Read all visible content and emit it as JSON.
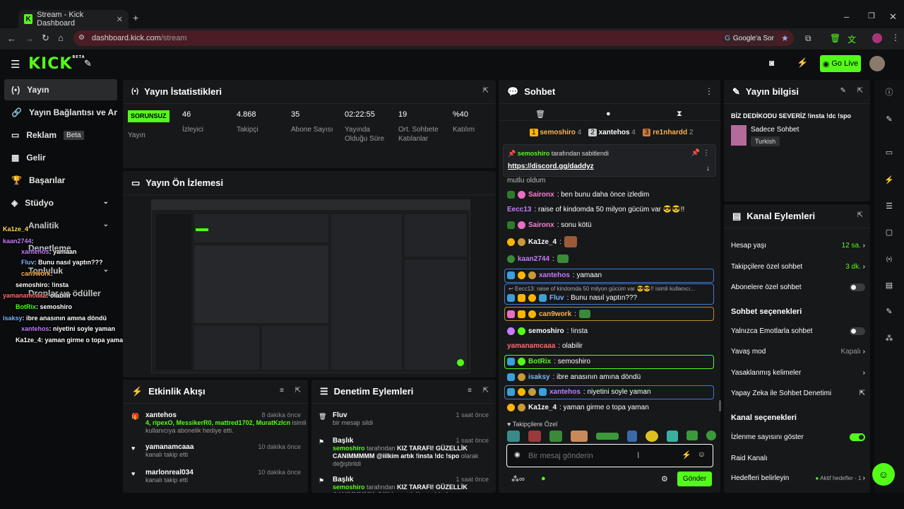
{
  "browser": {
    "tab_title": "Stream - Kick Dashboard",
    "url_host": "dashboard.kick.com",
    "url_path": "/stream",
    "ask_label": "Google'a Sor"
  },
  "header": {
    "logo": "KICK",
    "logo_beta": "BETA",
    "go_live": "Go Live"
  },
  "sidebar": {
    "items": [
      {
        "label": "Yayın"
      },
      {
        "label": "Yayın Bağlantısı ve Anahtar"
      },
      {
        "label": "Reklam",
        "badge": "Beta"
      },
      {
        "label": "Gelir"
      },
      {
        "label": "Başarılar"
      },
      {
        "label": "Stüdyo"
      },
      {
        "label": "Analitik"
      },
      {
        "label": "Denetleme"
      },
      {
        "label": "Topluluk"
      },
      {
        "label": "Droplar ve ödüller"
      }
    ]
  },
  "overlay_chat": [
    {
      "user": "Ka1ze_4",
      "text": ""
    },
    {
      "user": "kaan2744",
      "text": ":"
    },
    {
      "user": "xantehos",
      "text": ": yamaan"
    },
    {
      "user": "Fluv",
      "text": ": Bunu nasıl yaptın???"
    },
    {
      "user": "can9work",
      "text": ":"
    },
    {
      "user": "semoshiro",
      "text": ": !insta"
    },
    {
      "user": "yamanamcaaa",
      "text": ": olabilir"
    },
    {
      "user": "BotRix",
      "text": ": semoshiro"
    },
    {
      "user": "isaksy",
      "text": ": ibre anasının amına döndü"
    },
    {
      "user": "xantehos",
      "text": ": niyetini soyle yaman"
    },
    {
      "user": "Ka1ze_4",
      "text": ": yaman girme o topa yaman"
    }
  ],
  "stats": {
    "title": "Yayın İstatistikleri",
    "status_badge": "SORUNSUZ",
    "status_label": "Yayın",
    "items": [
      {
        "value": "46",
        "label": "İzleyici"
      },
      {
        "value": "4.868",
        "label": "Takipçi"
      },
      {
        "value": "35",
        "label": "Abone Sayısı"
      },
      {
        "value": "02:22:55",
        "label": "Yayında Olduğu Süre"
      },
      {
        "value": "19",
        "label": "Ort. Sohbete Katılanlar"
      },
      {
        "value": "%40",
        "label": "Katılım"
      }
    ]
  },
  "preview": {
    "title": "Yayın Ön İzlemesi"
  },
  "activity": {
    "title": "Etkinlik Akışı",
    "events": [
      {
        "name": "xantehos",
        "time": "8 dakika önce",
        "gifted": "4, ripexO, MessikerR0, mattred1702, MuratKzIcn",
        "desc": "isimli kullanıcıya abonelik hediye etti."
      },
      {
        "name": "yamanamcaaa",
        "time": "10 dakika önce",
        "desc": "kanalı takip etti"
      },
      {
        "name": "marlonreal034",
        "time": "10 dakika önce",
        "desc": "kanalı takip etti"
      }
    ]
  },
  "moderation": {
    "title": "Denetim Eylemleri",
    "actions": [
      {
        "name": "Fluv",
        "time": "1 saat önce",
        "desc": "bir mesajı sildi"
      },
      {
        "name": "Başlık",
        "time": "1 saat önce",
        "actor": "semoshiro",
        "desc_mid": "tarafından",
        "title_text": "KIZ TARAFI! GÜZELLİK CANIMMMMM @iilkim artık !insta !dc !spo",
        "desc_end": "olarak değiştirildi"
      },
      {
        "name": "Başlık",
        "time": "1 saat önce",
        "actor": "semoshiro",
        "desc_mid": "tarafından",
        "title_text": "KIZ TARAFI! GÜZELLİK CANIMMMMM @iilkim artık !insta !dc !spo"
      }
    ]
  },
  "chat": {
    "title": "Sohbet",
    "top_gifters": [
      {
        "rank": "1",
        "name": "semoshiro",
        "count": "4"
      },
      {
        "rank": "2",
        "name": "xantehos",
        "count": "4"
      },
      {
        "rank": "3",
        "name": "re1nhardd",
        "count": "2"
      }
    ],
    "pinned_by": "semoshiro",
    "pinned_label": "tarafından sabitlendi",
    "pinned_link": "https://discord.gg/daddyz",
    "partial_line": "mutlu oldum",
    "messages": [
      {
        "user": "Saironx",
        "text": ": ben bunu daha önce izledim",
        "color": "#ff7fd5"
      },
      {
        "user": "Eecc13",
        "text": ": raise of kindomda 50 milyon gücüm var 😎😎!!",
        "color": "#c57cff"
      },
      {
        "user": "Saironx",
        "text": ": sonu kötü",
        "color": "#ff7fd5"
      },
      {
        "user": "Ka1ze_4",
        "text": ":",
        "color": "#ffffff"
      },
      {
        "user": "kaan2744",
        "text": ":",
        "color": "#c57cff"
      },
      {
        "user": "xantehos",
        "text": ": yamaan",
        "color": "#c57cff"
      },
      {
        "reply": "Eecc13: raise of kindomda 50 milyon gücüm var 😎😎!! isimli kullanıcı...",
        "user": "Fluv",
        "text": ": Bunu nasıl yaptın???",
        "color": "#7ab7ff"
      },
      {
        "user": "can9work",
        "text": ":",
        "color": "#ffb14a"
      },
      {
        "user": "semoshiro",
        "text": ": !insta",
        "color": "#ffffff"
      },
      {
        "user": "yamanamcaaa",
        "text": ": olabilir",
        "color": "#ff6b6b"
      },
      {
        "user": "BotRix",
        "text": ": semoshiro",
        "color": "#53fc18"
      },
      {
        "user": "isaksy",
        "text": ": ibre anasının amına döndü",
        "color": "#7ab7ff"
      },
      {
        "user": "xantehos",
        "text": ": niyetini soyle yaman",
        "color": "#c57cff"
      },
      {
        "user": "Ka1ze_4",
        "text": ": yaman girme o topa yaman",
        "color": "#ffffff"
      }
    ],
    "emote_label": "Takipçilere Özel",
    "input_placeholder": "Bir mesaj gönderin",
    "send": "Gönder"
  },
  "stream_info": {
    "title": "Yayın bilgisi",
    "stream_title": "BİZ DEDİKODU SEVERİZ !insta !dc !spo",
    "category": "Sadece Sohbet",
    "tag": "Turkish"
  },
  "channel_actions": {
    "title": "Kanal Eylemleri",
    "rows1": [
      {
        "label": "Hesap yaşı",
        "value": "12 sa."
      },
      {
        "label": "Takipçilere özel sohbet",
        "value": "3 dk."
      },
      {
        "label": "Abonelere özel sohbet"
      }
    ],
    "chat_options_title": "Sohbet seçenekleri",
    "rows2": [
      {
        "label": "Yalnızca Emotlarla sohbet"
      },
      {
        "label": "Yavaş mod",
        "value": "Kapalı"
      },
      {
        "label": "Yasaklanmış kelimeler"
      },
      {
        "label": "Yapay Zeka ile Sohbet Denetimi"
      }
    ],
    "channel_options_title": "Kanal seçenekleri",
    "rows3": [
      {
        "label": "İzlenme sayısını göster"
      },
      {
        "label": "Raid Kanalı"
      },
      {
        "label": "Hedefleri belirleyin",
        "value": "Aktif hedefler - 1"
      }
    ]
  },
  "colors": {
    "accent": "#53fc18",
    "panel": "#17181a",
    "bg": "#0b0c0d"
  }
}
